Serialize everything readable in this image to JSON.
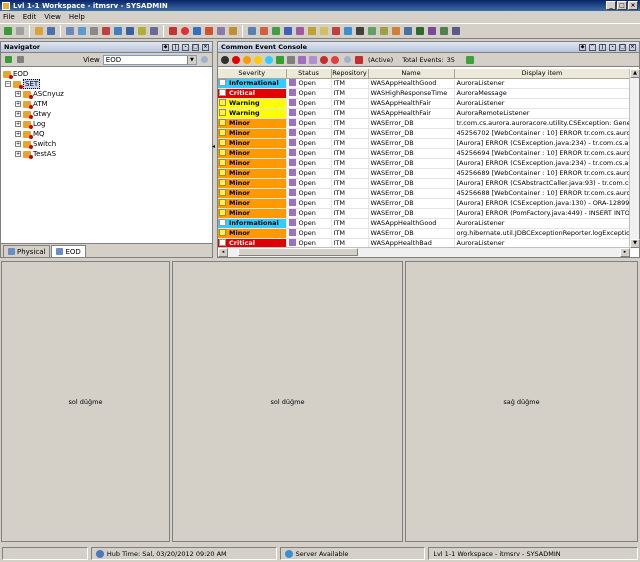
{
  "window": {
    "title": "Lvl 1-1 Workspace - itmsrv - SYSADMIN"
  },
  "menu": [
    "File",
    "Edit",
    "View",
    "Help"
  ],
  "navigator": {
    "title": "Navigator",
    "view_label": "View",
    "view_value": "EOD",
    "root": "EOD",
    "selected": "SET",
    "children": [
      "ASCnyuz",
      "ATM",
      "Gtwy",
      "Log",
      "MQ",
      "Switch",
      "TestAS"
    ],
    "tabs": [
      "Physical",
      "EOD"
    ]
  },
  "console": {
    "title": "Common Event Console",
    "active_label": "(Active)",
    "total_label": "Total Events:",
    "total_value": "35",
    "columns": [
      "Severity",
      "Status",
      "Repository",
      "Name",
      "Display item"
    ],
    "rows": [
      [
        "Informational",
        "Open",
        "ITM",
        "WASAppHealthGood",
        "AuroraListener"
      ],
      [
        "Critical",
        "Open",
        "ITM",
        "WASHighResponseTime",
        "AuroraMessage"
      ],
      [
        "Warning",
        "Open",
        "ITM",
        "WASAppHealthFair",
        "AuroraListener"
      ],
      [
        "Warning",
        "Open",
        "ITM",
        "WASAppHealthFair",
        "AuroraRemoteListener"
      ],
      [
        "Minor",
        "Open",
        "ITM",
        "WASError_DB",
        "tr.com.cs.aurora.auroracore.utility.CSException: Genel sis"
      ],
      [
        "Minor",
        "Open",
        "ITM",
        "WASError_DB",
        "45256702 [WebContainer : 10] ERROR tr.com.cs.aurora."
      ],
      [
        "Minor",
        "Open",
        "ITM",
        "WASError_DB",
        "[Aurora] ERROR (CSException.java:234) - tr.com.cs.auror"
      ],
      [
        "Minor",
        "Open",
        "ITM",
        "WASError_DB",
        "45256694 [WebContainer : 10] ERROR tr.com.cs.aurora."
      ],
      [
        "Minor",
        "Open",
        "ITM",
        "WASError_DB",
        "[Aurora] ERROR (CSException.java:234) - tr.com.cs.auror"
      ],
      [
        "Minor",
        "Open",
        "ITM",
        "WASError_DB",
        "45256689 [WebContainer : 10] ERROR tr.com.cs.aurora."
      ],
      [
        "Minor",
        "Open",
        "ITM",
        "WASError_DB",
        "[Aurora] ERROR (CSAbstractCaller.java:93) - tr.com.cs.au"
      ],
      [
        "Minor",
        "Open",
        "ITM",
        "WASError_DB",
        "45256688 [WebContainer : 10] ERROR tr.com.cs.aurora."
      ],
      [
        "Minor",
        "Open",
        "ITM",
        "WASError_DB",
        "[Aurora] ERROR (CSException.java:130) - ORA-12899: de"
      ],
      [
        "Minor",
        "Open",
        "ITM",
        "WASError_DB",
        "[Aurora] ERROR (PomFactory.java:449) - INSERT INTO C"
      ],
      [
        "Informational",
        "Open",
        "ITM",
        "WASAppHealthGood",
        "AuroraListener"
      ],
      [
        "Minor",
        "Open",
        "ITM",
        "WASError_DB",
        "org.hibernate.util.JDBCExceptionReporter.logExceptions"
      ],
      [
        "Critical",
        "Open",
        "ITM",
        "WASAppHealthBad",
        "AuroraListener"
      ]
    ]
  },
  "severity_colors": {
    "Informational": "#33ccff",
    "Critical": "#e00000",
    "Warning": "#ffff00",
    "Minor": "#ff9900"
  },
  "panes": {
    "left": "sol düğme",
    "middle": "sol düğme",
    "right": "sağ düğme"
  },
  "statusbar": {
    "hub_time": "Hub Time: Sal, 03/20/2012 09:20 AM",
    "server": "Server Available",
    "workspace": "Lvl 1-1 Workspace - itmsrv - SYSADMIN"
  }
}
